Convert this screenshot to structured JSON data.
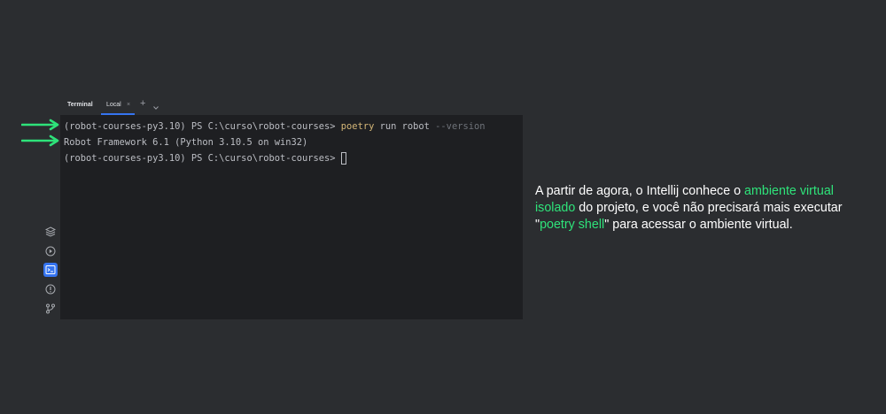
{
  "terminal": {
    "panel_title": "Terminal",
    "tab_label": "Local",
    "tab_close": "×",
    "add_tab": "+",
    "lines": {
      "line1_prompt": "(robot-courses-py3.10) PS C:\\curso\\robot-courses> ",
      "line1_command": "poetry",
      "line1_args": " run robot ",
      "line1_flag": "--version",
      "line2_output": "Robot Framework 6.1 (Python 3.10.5 on win32)",
      "line3_prompt": "(robot-courses-py3.10) PS C:\\curso\\robot-courses>"
    }
  },
  "caption": {
    "part1": "A partir de agora, o Intellij conhece o ",
    "highlight1": "ambiente virtual isolado",
    "part2": " do projeto, e você não precisará mais executar \"",
    "highlight2": "poetry shell",
    "part3": "\" para acessar o ambiente virtual."
  },
  "colors": {
    "background": "#2b2d30",
    "terminal_bg": "#1e1f22",
    "accent_green": "#2ee37a",
    "command_yellow": "#d5b778",
    "active_blue": "#3574f0"
  },
  "icons": [
    "layers-icon",
    "run-icon",
    "terminal-icon",
    "problems-icon",
    "git-icon",
    "arrow-right-icon"
  ]
}
